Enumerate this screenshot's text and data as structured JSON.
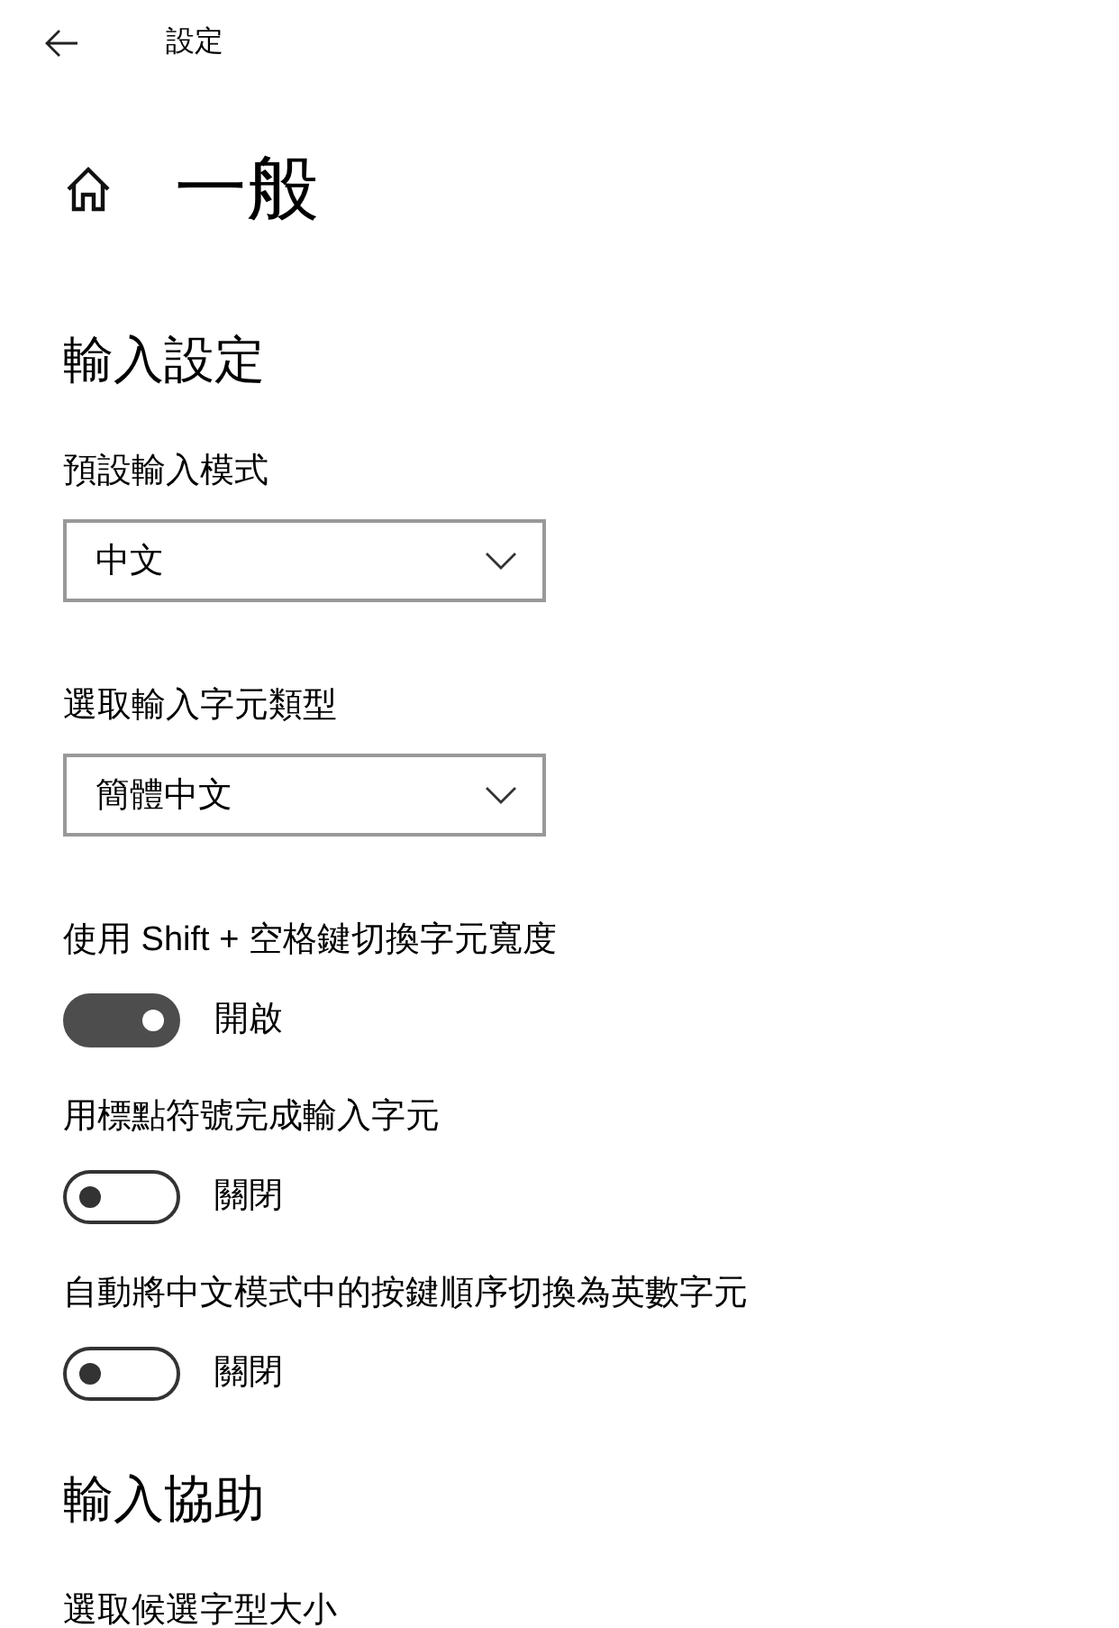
{
  "header": {
    "title": "設定"
  },
  "page": {
    "title": "一般"
  },
  "sections": [
    {
      "title": "輸入設定",
      "items": [
        {
          "kind": "dropdown",
          "label": "預設輸入模式",
          "value": "中文"
        },
        {
          "kind": "dropdown",
          "label": "選取輸入字元類型",
          "value": "簡體中文"
        },
        {
          "kind": "toggle",
          "label": "使用 Shift + 空格鍵切換字元寬度",
          "on": true,
          "state_text": "開啟"
        },
        {
          "kind": "toggle",
          "label": "用標點符號完成輸入字元",
          "on": false,
          "state_text": "關閉"
        },
        {
          "kind": "toggle",
          "label": "自動將中文模式中的按鍵順序切換為英數字元",
          "on": false,
          "state_text": "關閉"
        }
      ]
    },
    {
      "title": "輸入協助",
      "items": [
        {
          "kind": "label",
          "label": "選取候選字型大小"
        }
      ]
    }
  ]
}
